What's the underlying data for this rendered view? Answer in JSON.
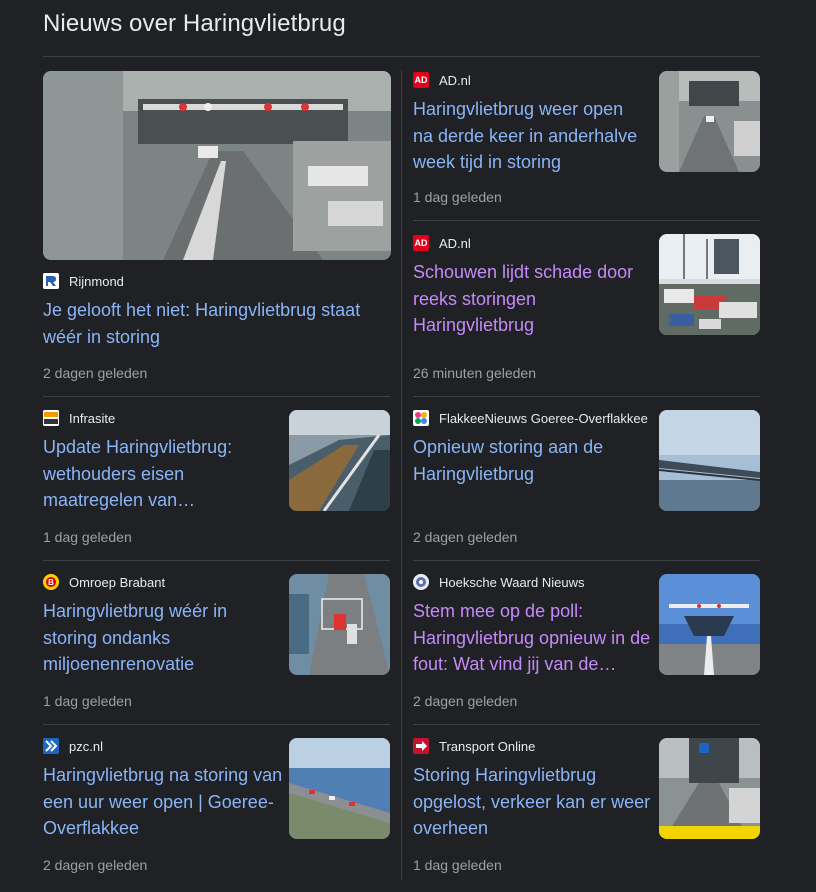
{
  "section_title": "Nieuws over Haringvlietbrug",
  "colors": {
    "background": "#202124",
    "link": "#8ab4f8",
    "visited_link": "#c58af9",
    "meta": "#9aa0a6"
  },
  "items": [
    {
      "source": "Rijnmond",
      "logo_icon": "rijnmond-logo-icon",
      "headline": "Je gelooft het niet: Haringvlietbrug staat wéér in storing",
      "time": "2 dagen geleden",
      "visited": false
    },
    {
      "source": "AD.nl",
      "logo_icon": "ad-logo-icon",
      "headline": "Haringvlietbrug weer open na derde keer in anderhalve week tijd in storing",
      "time": "1 dag geleden",
      "visited": false
    },
    {
      "source": "AD.nl",
      "logo_icon": "ad-logo-icon",
      "headline": "Schouwen lijdt schade door reeks storingen Haringvlietbrug",
      "time": "26 minuten geleden",
      "visited": true
    },
    {
      "source": "Infrasite",
      "logo_icon": "infrasite-logo-icon",
      "headline": "Update Haringvlietbrug: wethouders eisen maatregelen van…",
      "time": "1 dag geleden",
      "visited": false
    },
    {
      "source": "FlakkeeNieuws Goeree-Overflakkee",
      "logo_icon": "flakkeenieuws-logo-icon",
      "headline": "Opnieuw storing aan de Haringvlietbrug",
      "time": "2 dagen geleden",
      "visited": false
    },
    {
      "source": "Omroep Brabant",
      "logo_icon": "omroep-brabant-logo-icon",
      "headline": "Haringvlietbrug wéér in storing ondanks miljoenenrenovatie",
      "time": "1 dag geleden",
      "visited": false
    },
    {
      "source": "Hoeksche Waard Nieuws",
      "logo_icon": "hoeksche-waard-logo-icon",
      "headline": "Stem mee op de poll: Haringvlietbrug opnieuw in de fout: Wat vind jij van de…",
      "time": "2 dagen geleden",
      "visited": true
    },
    {
      "source": "pzc.nl",
      "logo_icon": "pzc-logo-icon",
      "headline": "Haringvlietbrug na storing van een uur weer open | Goeree-Overflakkee",
      "time": "2 dagen geleden",
      "visited": false
    },
    {
      "source": "Transport Online",
      "logo_icon": "transport-online-logo-icon",
      "headline": "Storing Haringvlietbrug opgelost, verkeer kan er weer overheen",
      "time": "1 dag geleden",
      "visited": false
    }
  ]
}
